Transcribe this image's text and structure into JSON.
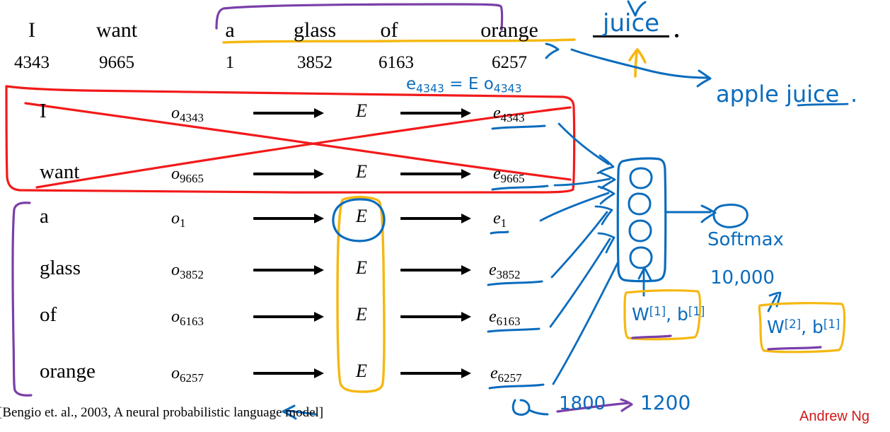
{
  "slide": {
    "title_sentence": {
      "words": [
        "I",
        "want",
        "a",
        "glass",
        "of",
        "orange"
      ],
      "indices": [
        "4343",
        "9665",
        "1",
        "3852",
        "6163",
        "6257"
      ]
    },
    "rows": [
      {
        "word": "I",
        "o_label": "o",
        "o_index": "4343",
        "E": "E",
        "e_label": "e",
        "e_index": "4343"
      },
      {
        "word": "want",
        "o_label": "o",
        "o_index": "9665",
        "E": "E",
        "e_label": "e",
        "e_index": "9665"
      },
      {
        "word": "a",
        "o_label": "o",
        "o_index": "1",
        "E": "E",
        "e_label": "e",
        "e_index": "1"
      },
      {
        "word": "glass",
        "o_label": "o",
        "o_index": "3852",
        "E": "E",
        "e_label": "e",
        "e_index": "3852"
      },
      {
        "word": "of",
        "o_label": "o",
        "o_index": "6163",
        "E": "E",
        "e_label": "e",
        "e_index": "6163"
      },
      {
        "word": "orange",
        "o_label": "o",
        "o_index": "6257",
        "E": "E",
        "e_label": "e",
        "e_index": "6257"
      }
    ],
    "citation": "[Bengio et. al., 2003, A neural probabilistic language model]",
    "signature": "Andrew Ng"
  },
  "annotations": {
    "target_word": "juice",
    "target_period": ".",
    "alternative_phrase": "apple juice",
    "embedding_formula": {
      "lhs": "e",
      "lhs_sub": "4343",
      "equals": "=",
      "matrix": "E",
      "rhs": "o",
      "rhs_sub": "4343",
      "full": "e4343 = E o4343"
    },
    "softmax_label": "Softmax",
    "vocab_size": "10,000",
    "layer1_params": {
      "w": "W",
      "w_sup": "[1]",
      "comma": ",",
      "b": "b",
      "b_sup": "[1]"
    },
    "layer2_params": {
      "w": "W",
      "w_sup": "[2]",
      "comma": ",",
      "b": "b",
      "b_sup": "[1]"
    },
    "dimension_crossed_out": "1800",
    "dimension_corrected": "1200"
  },
  "colors": {
    "blue_ink": "#0b6cbd",
    "red_ink": "#f21a1a",
    "yellow_ink": "#f5b811",
    "purple_ink": "#7a3fa8",
    "black_text": "#000000",
    "signature_red": "#d11a1a"
  }
}
